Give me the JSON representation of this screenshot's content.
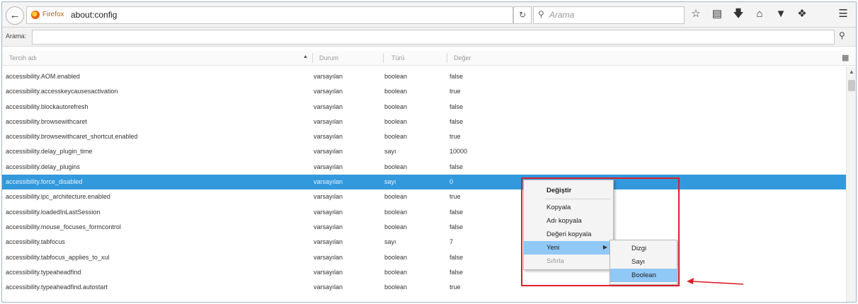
{
  "browser": {
    "identity_label": "Firefox",
    "url": "about:config",
    "search_placeholder": "Arama",
    "icons": [
      "back-arrow-icon",
      "reload-icon",
      "search-icon",
      "bookmark-star-icon",
      "reading-list-icon",
      "download-icon",
      "home-icon",
      "pocket-icon",
      "extension-icon",
      "menu-icon"
    ]
  },
  "filter": {
    "label": "Arama:",
    "value": ""
  },
  "columns": {
    "name": "Tercih adı",
    "status": "Durum",
    "type": "Türü",
    "value": "Değer"
  },
  "rows": [
    {
      "name": "accessibility.AOM.enabled",
      "status": "varsayılan",
      "type": "boolean",
      "value": "false"
    },
    {
      "name": "accessibility.accesskeycausesactivation",
      "status": "varsayılan",
      "type": "boolean",
      "value": "true"
    },
    {
      "name": "accessibility.blockautorefresh",
      "status": "varsayılan",
      "type": "boolean",
      "value": "false"
    },
    {
      "name": "accessibility.browsewithcaret",
      "status": "varsayılan",
      "type": "boolean",
      "value": "false"
    },
    {
      "name": "accessibility.browsewithcaret_shortcut.enabled",
      "status": "varsayılan",
      "type": "boolean",
      "value": "true"
    },
    {
      "name": "accessibility.delay_plugin_time",
      "status": "varsayılan",
      "type": "sayı",
      "value": "10000"
    },
    {
      "name": "accessibility.delay_plugins",
      "status": "varsayılan",
      "type": "boolean",
      "value": "false"
    },
    {
      "name": "accessibility.force_disabled",
      "status": "varsayılan",
      "type": "sayı",
      "value": "0"
    },
    {
      "name": "accessibility.ipc_architecture.enabled",
      "status": "varsayılan",
      "type": "boolean",
      "value": "true"
    },
    {
      "name": "accessibility.loadedInLastSession",
      "status": "varsayılan",
      "type": "boolean",
      "value": "false"
    },
    {
      "name": "accessibility.mouse_focuses_formcontrol",
      "status": "varsayılan",
      "type": "boolean",
      "value": "false"
    },
    {
      "name": "accessibility.tabfocus",
      "status": "varsayılan",
      "type": "sayı",
      "value": "7"
    },
    {
      "name": "accessibility.tabfocus_applies_to_xul",
      "status": "varsayılan",
      "type": "boolean",
      "value": "false"
    },
    {
      "name": "accessibility.typeaheadfind",
      "status": "varsayılan",
      "type": "boolean",
      "value": "false"
    },
    {
      "name": "accessibility.typeaheadfind.autostart",
      "status": "varsayılan",
      "type": "boolean",
      "value": "true"
    }
  ],
  "selected_row_index": 7,
  "context_menu": {
    "items": {
      "modify": "Değiştir",
      "copy": "Kopyala",
      "copy_name": "Adı kopyala",
      "copy_value": "Değeri kopyala",
      "new": "Yeni",
      "reset": "Sıfırla"
    },
    "submenu": {
      "string": "Dizgi",
      "integer": "Sayı",
      "boolean": "Boolean"
    }
  },
  "colors": {
    "selection": "#3399dd",
    "menu_highlight": "#90c8f6",
    "annotation": "#d9212b"
  }
}
